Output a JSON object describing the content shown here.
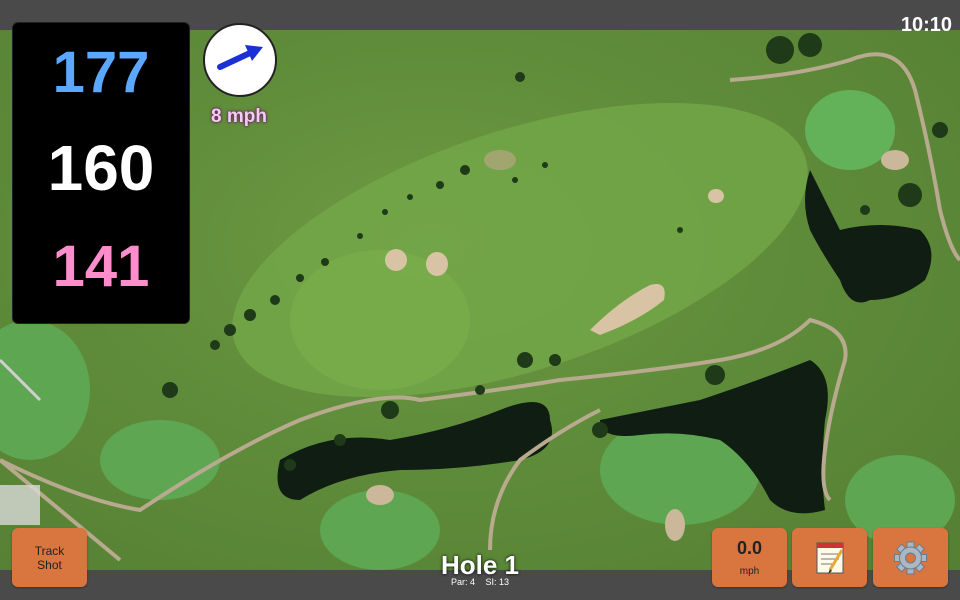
{
  "status_bar": {
    "time": "10:10"
  },
  "distances": {
    "back": "177",
    "middle": "160",
    "front": "141"
  },
  "wind": {
    "speed": "8 mph",
    "direction_icon": "arrow-icon"
  },
  "buttons": {
    "track_shot_line1": "Track",
    "track_shot_line2": "Shot",
    "speed_value": "0.0",
    "speed_unit": "mph",
    "notes_icon": "notepad-icon",
    "settings_icon": "gear-icon"
  },
  "hole": {
    "title": "Hole 1",
    "par": "Par: 4",
    "si": "SI: 13"
  },
  "colors": {
    "back": "#5aa8ff",
    "middle": "#ffffff",
    "front": "#ff8dcc",
    "button": "#d9753f",
    "bar": "#4a4a4a"
  }
}
